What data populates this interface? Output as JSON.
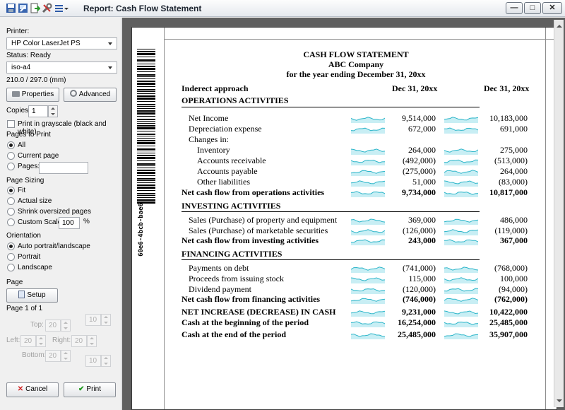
{
  "window": {
    "title": "Report: Cash Flow Statement",
    "toolbar_icons": [
      "save-icon",
      "export-icon",
      "send-icon",
      "tools-icon",
      "menu-icon"
    ],
    "controls": {
      "minimize": "—",
      "maximize": "□",
      "close": "✕"
    }
  },
  "panel": {
    "printer_label": "Printer:",
    "printer_value": "HP Color LaserJet PS",
    "status": "Status: Ready",
    "paper_value": "iso-a4",
    "paper_size": "210.0 / 297.0 (mm)",
    "properties_btn": "Properties",
    "advanced_btn": "Advanced",
    "copies_label": "Copies:",
    "copies_value": "1",
    "grayscale_label": "Print in grayscale (black and white)",
    "pages_to_print_label": "Pages to Print",
    "pages_options": [
      "All",
      "Current page",
      "Pages:"
    ],
    "page_sizing_label": "Page Sizing",
    "sizing_options": [
      "Fit",
      "Actual size",
      "Shrink oversized pages",
      "Custom Scale:"
    ],
    "custom_scale_value": "100",
    "custom_scale_unit": "%",
    "orientation_label": "Orientation",
    "orientation_options": [
      "Auto portrait/landscape",
      "Portrait",
      "Landscape"
    ],
    "page_label": "Page",
    "setup_btn": "Setup",
    "page_of": "Page 1 of 1",
    "top_label": "Top:",
    "left_label": "Left:",
    "right_label": "Right:",
    "bottom_label": "Bottom:",
    "margin_value": "20",
    "margin_value2": "10",
    "cancel_btn": "Cancel",
    "print_btn": "Print"
  },
  "report": {
    "barcode_text": "60e6-4bcb-bae6",
    "title": "CASH FLOW STATEMENT",
    "company": "ABC Company",
    "period": "for the year ending December 31, 20xx",
    "method": "Inderect approach",
    "col1": "Dec 31, 20xx",
    "col2": "Dec 31, 20xx",
    "sections": {
      "operations": "OPERATIONS ACTIVITIES",
      "investing": "INVESTING ACTIVITIES",
      "financing": "FINANCING ACTIVITIES"
    },
    "rows": [
      {
        "label": "Net Income",
        "v1": "9,514,000",
        "v2": "10,183,000"
      },
      {
        "label": "Depreciation expense",
        "v1": "672,000",
        "v2": "691,000"
      },
      {
        "label": "Changes in:",
        "v1": "",
        "v2": ""
      },
      {
        "label": "Inventory",
        "v1": "264,000",
        "v2": "275,000"
      },
      {
        "label": "Accounts receivable",
        "v1": "(492,000)",
        "v2": "(513,000)"
      },
      {
        "label": "Accounts payable",
        "v1": "(275,000)",
        "v2": "264,000"
      },
      {
        "label": "Other liabilities",
        "v1": "51,000",
        "v2": "(83,000)"
      },
      {
        "label": "Net cash flow from operations activities",
        "v1": "9,734,000",
        "v2": "10,817,000"
      },
      {
        "label": "Sales (Purchase) of property and equipment",
        "v1": "369,000",
        "v2": "486,000"
      },
      {
        "label": "Sales (Purchase) of marketable securities",
        "v1": "(126,000)",
        "v2": "(119,000)"
      },
      {
        "label": "Net cash flow from investing activities",
        "v1": "243,000",
        "v2": "367,000"
      },
      {
        "label": "Payments on debt",
        "v1": "(741,000)",
        "v2": "(768,000)"
      },
      {
        "label": "Proceeds from issuing stock",
        "v1": "115,000",
        "v2": "100,000"
      },
      {
        "label": "Dividend payment",
        "v1": "(120,000)",
        "v2": "(94,000)"
      },
      {
        "label": "Net cash flow from financing activities",
        "v1": "(746,000)",
        "v2": "(762,000)"
      },
      {
        "label": "NET INCREASE (DECREASE) IN CASH",
        "v1": "9,231,000",
        "v2": "10,422,000"
      },
      {
        "label": "Cash at the beginning of the period",
        "v1": "16,254,000",
        "v2": "25,485,000"
      },
      {
        "label": "Cash at the end of the period",
        "v1": "25,485,000",
        "v2": "35,907,000"
      }
    ]
  },
  "colors": {
    "sparkline": "#2bb5c9",
    "spark_fill": "#c8eef4",
    "preview_bg": "#5f5f5f"
  }
}
